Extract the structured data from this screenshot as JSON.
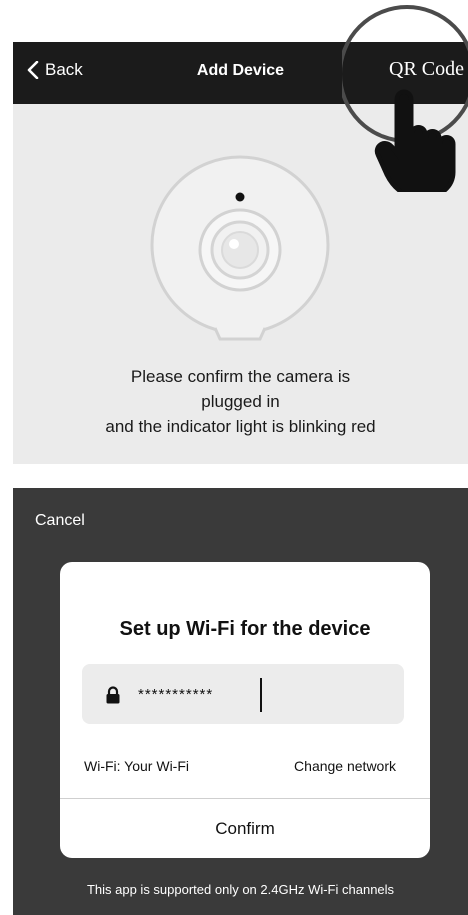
{
  "header": {
    "back_label": "Back",
    "title": "Add Device",
    "qr_label": "QR Code"
  },
  "instructions": {
    "line1": "Please confirm the camera is",
    "line2": "plugged in",
    "line3": "and the indicator light is blinking red"
  },
  "dialog": {
    "cancel_label": "Cancel",
    "title": "Set up Wi-Fi for the device",
    "password_value": "***********",
    "wifi_label": "Wi-Fi: Your Wi-Fi",
    "change_network_label": "Change network",
    "confirm_label": "Confirm"
  },
  "footnote": "This app is supported only on 2.4GHz Wi-Fi channels",
  "colors": {
    "header_bg": "#1b1b1b",
    "panel_bg": "#ebebeb",
    "overlay_bg": "#3a3a3a",
    "card_bg": "#ffffff",
    "field_bg": "#ececec"
  },
  "icons": [
    "back-chevron-icon",
    "camera-illustration",
    "magnifier-icon",
    "pointing-hand-icon",
    "lock-icon"
  ]
}
